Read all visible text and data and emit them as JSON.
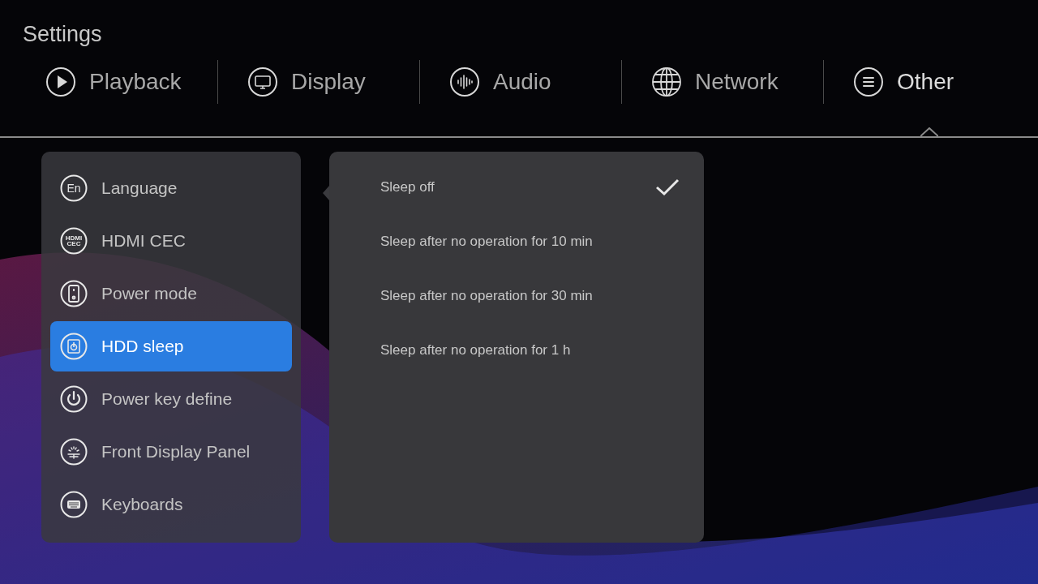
{
  "title": "Settings",
  "tabs": [
    {
      "label": "Playback",
      "kind": "play",
      "selected": false
    },
    {
      "label": "Display",
      "kind": "display",
      "selected": false
    },
    {
      "label": "Audio",
      "kind": "audio",
      "selected": false
    },
    {
      "label": "Network",
      "kind": "network",
      "selected": false
    },
    {
      "label": "Other",
      "kind": "other",
      "selected": true
    }
  ],
  "menu": [
    {
      "label": "Language",
      "kind": "text",
      "icon_text": [
        "En"
      ],
      "selected": false
    },
    {
      "label": "HDMI CEC",
      "kind": "text",
      "icon_text": [
        "HDMI",
        "CEC"
      ],
      "selected": false
    },
    {
      "label": "Power mode",
      "kind": "device",
      "selected": false
    },
    {
      "label": "HDD sleep",
      "kind": "disk",
      "selected": true
    },
    {
      "label": "Power key define",
      "kind": "power",
      "selected": false
    },
    {
      "label": "Front Display Panel",
      "kind": "panel",
      "selected": false
    },
    {
      "label": "Keyboards",
      "kind": "keyboard",
      "selected": false
    }
  ],
  "options": [
    {
      "label": "Sleep off",
      "selected": true
    },
    {
      "label": "Sleep after no operation for 10 min",
      "selected": false
    },
    {
      "label": "Sleep after no operation for 30 min",
      "selected": false
    },
    {
      "label": "Sleep after no operation for 1 h",
      "selected": false
    }
  ]
}
